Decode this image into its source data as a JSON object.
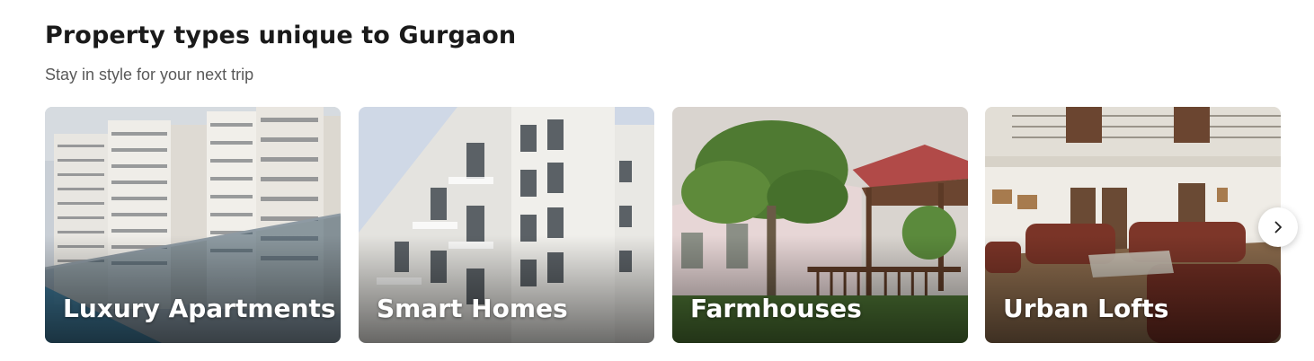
{
  "section": {
    "title": "Property types unique to Gurgaon",
    "subtitle": "Stay in style for your next trip"
  },
  "cards": [
    {
      "label": "Luxury Apartments",
      "image": "apartment-towers-photo"
    },
    {
      "label": "Smart Homes",
      "image": "white-building-photo"
    },
    {
      "label": "Farmhouses",
      "image": "cottage-garden-photo"
    },
    {
      "label": "Urban Lofts",
      "image": "living-room-photo"
    }
  ],
  "carousel": {
    "next_icon": "chevron-right-icon"
  }
}
